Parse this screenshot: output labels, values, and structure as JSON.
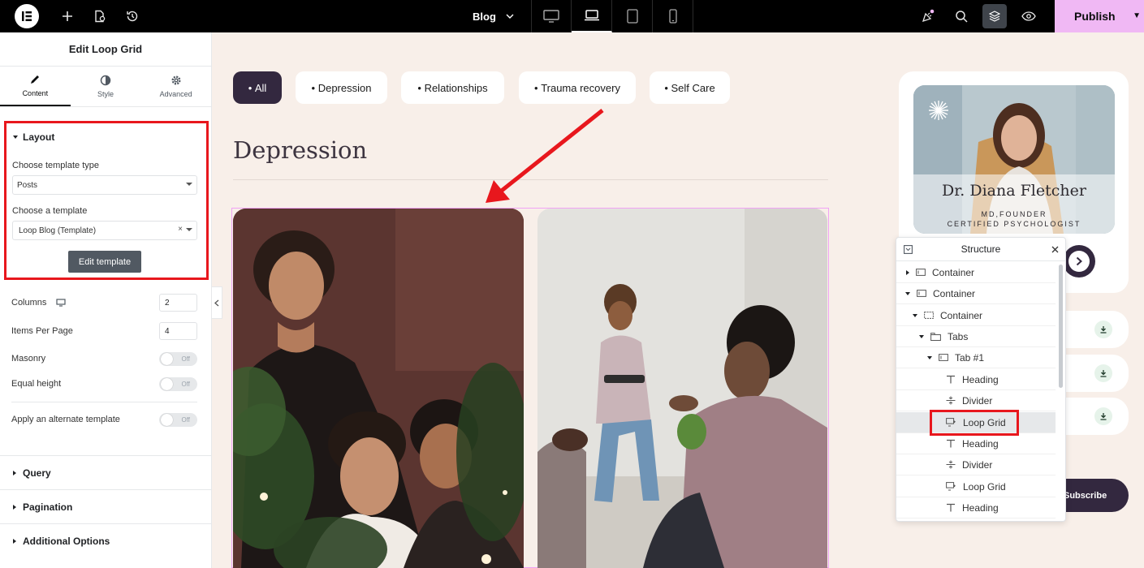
{
  "topbar": {
    "page_name": "Blog",
    "publish_label": "Publish",
    "icons": [
      "elementor-logo-icon",
      "add-icon",
      "page-settings-icon",
      "history-icon",
      "desktop-icon",
      "laptop-icon",
      "tablet-icon",
      "mobile-icon",
      "notifications-icon",
      "search-icon",
      "structure-icon",
      "preview-icon"
    ]
  },
  "panel": {
    "title": "Edit Loop Grid",
    "tabs": [
      {
        "label": "Content",
        "icon": "pencil-icon"
      },
      {
        "label": "Style",
        "icon": "half-circle-icon"
      },
      {
        "label": "Advanced",
        "icon": "gear-icon"
      }
    ],
    "layout": {
      "heading": "Layout",
      "template_type_label": "Choose template type",
      "template_type_value": "Posts",
      "template_label": "Choose a template",
      "template_value": "Loop Blog (Template)",
      "edit_button": "Edit template"
    },
    "controls": {
      "columns_label": "Columns",
      "columns_value": "2",
      "items_label": "Items Per Page",
      "items_value": "4",
      "masonry_label": "Masonry",
      "masonry_value": "Off",
      "equal_label": "Equal height",
      "equal_value": "Off",
      "alternate_label": "Apply an alternate template",
      "alternate_value": "Off"
    },
    "sections": [
      "Query",
      "Pagination",
      "Additional Options"
    ]
  },
  "canvas": {
    "filters": [
      {
        "label": "All",
        "active": true
      },
      {
        "label": "Depression",
        "active": false
      },
      {
        "label": "Relationships",
        "active": false
      },
      {
        "label": "Trauma recovery",
        "active": false
      },
      {
        "label": "Self Care",
        "active": false
      }
    ],
    "heading": "Depression"
  },
  "profile": {
    "name": "Dr. Diana Fletcher",
    "title1": "MD,FOUNDER",
    "title2": "CERTIFIED PSYCHOLOGIST",
    "subscribe": "Subscribe"
  },
  "structure": {
    "title": "Structure",
    "items": [
      {
        "label": "Container",
        "depth": 0,
        "expand": "collapsed",
        "icon": "container-icon"
      },
      {
        "label": "Container",
        "depth": 0,
        "expand": "expanded",
        "icon": "container-icon"
      },
      {
        "label": "Container",
        "depth": 1,
        "expand": "expanded",
        "icon": "container-icon"
      },
      {
        "label": "Tabs",
        "depth": 2,
        "expand": "expanded",
        "icon": "tabs-icon"
      },
      {
        "label": "Tab #1",
        "depth": 3,
        "expand": "expanded",
        "icon": "container-icon"
      },
      {
        "label": "Heading",
        "depth": 4,
        "expand": "none",
        "icon": "heading-icon"
      },
      {
        "label": "Divider",
        "depth": 4,
        "expand": "none",
        "icon": "divider-icon"
      },
      {
        "label": "Loop Grid",
        "depth": 4,
        "expand": "none",
        "icon": "loop-grid-icon",
        "selected": true
      },
      {
        "label": "Heading",
        "depth": 4,
        "expand": "none",
        "icon": "heading-icon"
      },
      {
        "label": "Divider",
        "depth": 4,
        "expand": "none",
        "icon": "divider-icon"
      },
      {
        "label": "Loop Grid",
        "depth": 4,
        "expand": "none",
        "icon": "loop-grid-icon"
      },
      {
        "label": "Heading",
        "depth": 4,
        "expand": "none",
        "icon": "heading-icon"
      }
    ]
  },
  "colors": {
    "accent_dark": "#33283f",
    "publish_bg": "#f0b8f4",
    "highlight_red": "#e8171d",
    "canvas_bg": "#f8efe9"
  }
}
